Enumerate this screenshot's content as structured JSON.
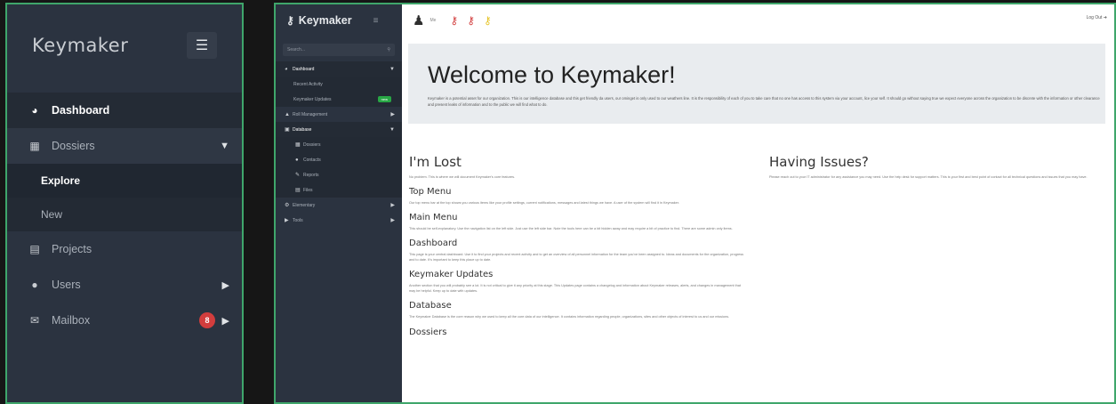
{
  "left_sidebar": {
    "brand": "Keymaker",
    "toggle_icon": "hamburger-icon",
    "items": [
      {
        "label": "Dashboard",
        "icon": "speedometer-icon"
      },
      {
        "label": "Dossiers",
        "icon": "grid-icon"
      },
      {
        "label": "Explore"
      },
      {
        "label": "New"
      },
      {
        "label": "Projects",
        "icon": "file-icon"
      },
      {
        "label": "Users",
        "icon": "users-icon"
      },
      {
        "label": "Mailbox",
        "icon": "envelope-icon",
        "badge": "8"
      }
    ]
  },
  "app": {
    "brand": "Keymaker",
    "sidebar": {
      "search_placeholder": "Search...",
      "items": [
        {
          "label": "Dashboard"
        },
        {
          "label": "Recent Activity"
        },
        {
          "label": "Keymaker Updates",
          "badge": "new"
        },
        {
          "label": "Roll Management"
        },
        {
          "label": "Database"
        },
        {
          "label": "Dossiers"
        },
        {
          "label": "Contacts"
        },
        {
          "label": "Reports"
        },
        {
          "label": "Files"
        },
        {
          "label": "Elementary"
        },
        {
          "label": "Tools"
        }
      ]
    },
    "topbar": {
      "user_label": "Me",
      "logout": "Log Out"
    },
    "welcome": {
      "title": "Welcome to Keymaker!",
      "text": "Keymaker is a potential asset for our organization. This is our intelligence database and this get friendly da users, our ominget is only used to our weathers line. It is the responsibility of each of you to take care that no one has access to this system via your account, lice your self. It should go without saying true we expect everyone across the organization to be discrete with the information or other clearance and present leaks of information and to the public we will find what to do."
    },
    "lost": {
      "title": "I'm Lost",
      "intro": "No problem. This is where we will document Keymaker's core features.",
      "sections": [
        {
          "heading": "Top Menu",
          "text": "Our top menu bar at the top shows you various items like your profile settings, current notifications, messages and latest things we have. A user of the system will find it in Keymaker."
        },
        {
          "heading": "Main Menu",
          "text": "This should be self-explanatory. Use the navigation list on the left side. Just use the left side bar. Note the tools here can be a bit hidden away and may require a bit of practice to find. There are some admin only items."
        },
        {
          "heading": "Dashboard",
          "text": "This page is your central dashboard. Use it to find your projects and recent activity and to get an overview of all personnel information for the team you've been assigned to. Ideas and documents for the organization, progress and to date. It's important to keep this place up to date."
        },
        {
          "heading": "Keymaker Updates",
          "text": "Another section that you will probably see a lot. It is not critical to give it any priority at this stage. This Updates page contains a changelog and information about Keymaker releases, alerts, and changes in management that may be helpful. Keep up to date with updates."
        },
        {
          "heading": "Database",
          "text": "The Keymaker Database is the core reason why we used to keep all the core data of our intelligence. It contains information regarding people, organizations, sites and other objects of interest to us and our missions."
        },
        {
          "heading": "Dossiers",
          "text": ""
        }
      ]
    },
    "issues": {
      "title": "Having Issues?",
      "text": "Please reach out to your IT administrator for any assistance you may need. Use the help desk for support matters. This is your first and best point of contact for all technical questions and issues that you may have."
    }
  }
}
